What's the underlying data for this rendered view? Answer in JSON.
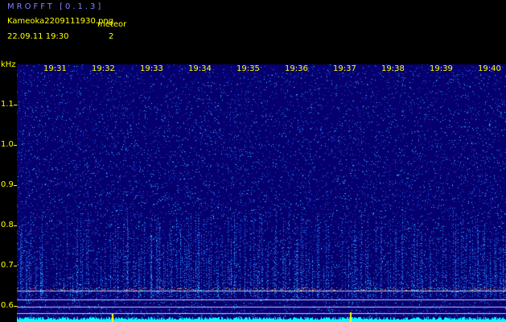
{
  "app": {
    "title": "MROFFT [0.1.3]"
  },
  "file": {
    "name": "Kameoka2209111930.png"
  },
  "meteor": {
    "label": "meteor",
    "count": "2"
  },
  "session": {
    "datetime": "22.09.11  19:30"
  },
  "axis": {
    "y_unit": "kHz",
    "y_ticks": [
      "1.1",
      "1.0",
      "0.9",
      "0.8",
      "0.7",
      "0.6"
    ],
    "x_ticks": [
      "19:31",
      "19:32",
      "19:33",
      "19:34",
      "19:35",
      "19:36",
      "19:37",
      "19:38",
      "19:39",
      "19:40"
    ]
  },
  "colors": {
    "background": "#06006e",
    "noise": "#1e78ff",
    "echo": "#00ffff",
    "band": "#ff3060",
    "text": "#ffff00",
    "title": "#8080ff"
  }
}
